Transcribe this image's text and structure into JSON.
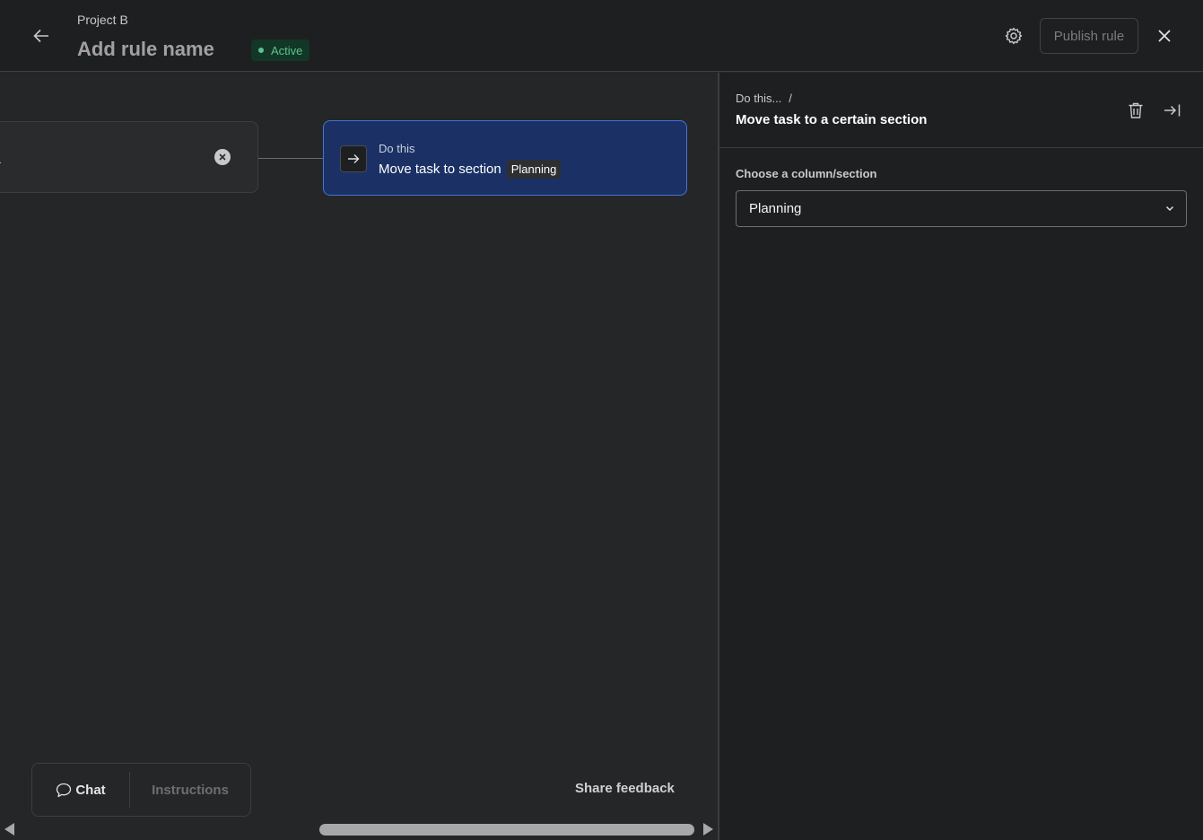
{
  "header": {
    "project_name": "Project B",
    "rule_name": "Add rule name",
    "status": "Active",
    "publish_label": "Publish rule"
  },
  "canvas": {
    "trigger": {
      "text": "."
    },
    "action": {
      "kicker": "Do this",
      "title": "Move task to section",
      "section_chip": "Planning"
    },
    "bottom_tabs": {
      "chat": "Chat",
      "instructions": "Instructions"
    },
    "share_feedback": "Share feedback"
  },
  "panel": {
    "breadcrumb": "Do this...",
    "breadcrumb_sep": "/",
    "title": "Move task to a certain section",
    "field_label": "Choose a column/section",
    "selected_section": "Planning"
  },
  "colors": {
    "status_green": "#5ec290",
    "action_fill": "#1b3165",
    "action_border": "#4573d2"
  },
  "icons": [
    "arrow-left-icon",
    "gear-icon",
    "close-icon",
    "x-circle-icon",
    "arrow-right-icon",
    "chat-bubble-icon",
    "trash-icon",
    "collapse-panel-icon",
    "chevron-down-icon"
  ]
}
